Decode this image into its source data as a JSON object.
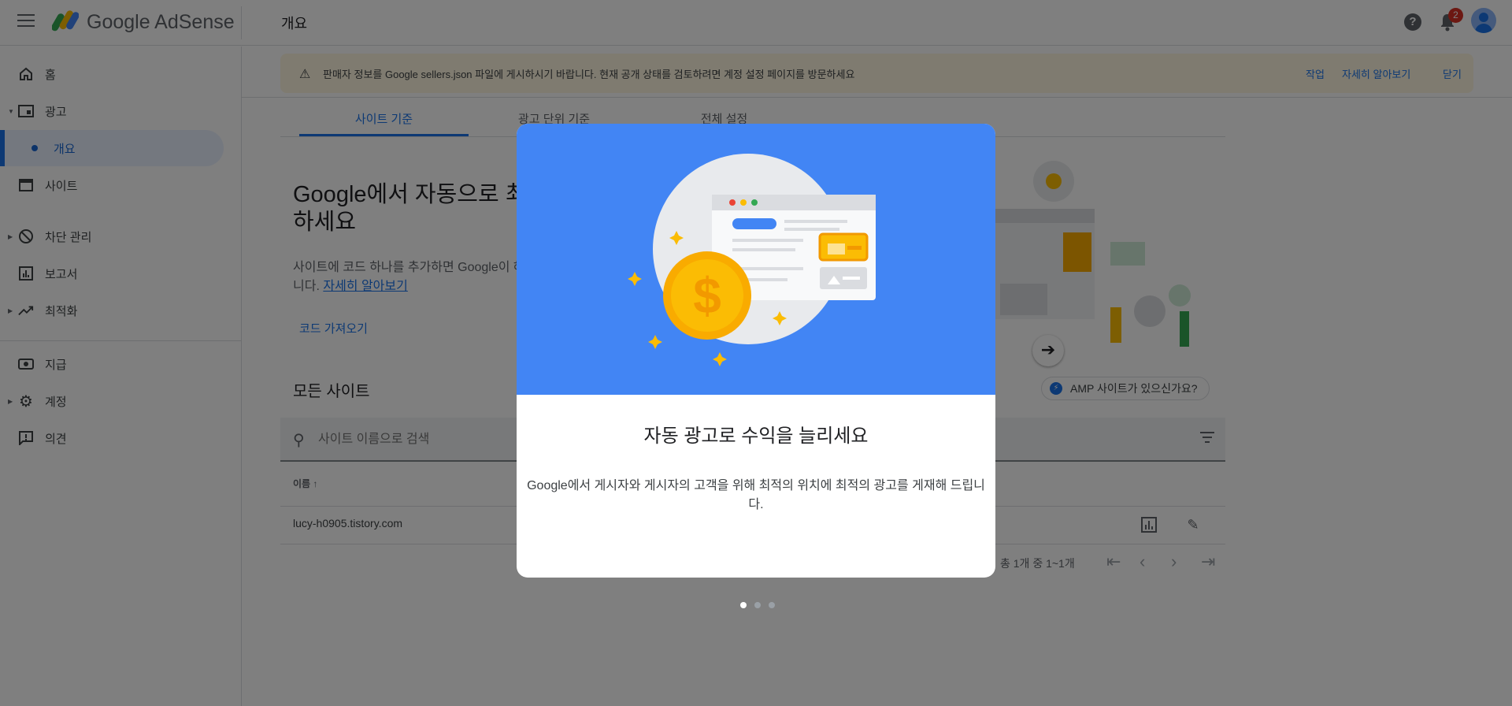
{
  "header": {
    "product_name": "Google AdSense",
    "page_title": "개요",
    "notification_count": "2"
  },
  "sidebar": {
    "items": [
      {
        "label": "홈",
        "icon": "home-icon"
      },
      {
        "label": "광고",
        "icon": "ads-icon"
      },
      {
        "label": "개요",
        "icon": "dot-icon"
      },
      {
        "label": "사이트",
        "icon": "sites-icon"
      },
      {
        "label": "차단 관리",
        "icon": "block-icon"
      },
      {
        "label": "보고서",
        "icon": "report-icon"
      },
      {
        "label": "최적화",
        "icon": "optimize-icon"
      },
      {
        "label": "지급",
        "icon": "payment-icon"
      },
      {
        "label": "계정",
        "icon": "gear-icon"
      },
      {
        "label": "의견",
        "icon": "feedback-icon"
      }
    ]
  },
  "banner": {
    "message": "판매자 정보를 Google sellers.json 파일에 게시하시기 바랍니다. 현재 공개 상태를 검토하려면 계정 설정 페이지를 방문하세요",
    "action_label": "작업",
    "learn_more_label": "자세히 알아보기",
    "close_label": "닫기"
  },
  "tabs": [
    {
      "label": "사이트 기준"
    },
    {
      "label": "광고 단위 기준"
    },
    {
      "label": "전체 설정"
    }
  ],
  "hero": {
    "title": "Google에서 자동으로 최 하도록 하세요",
    "description": "사이트에 코드 하나를 추가하면 Google이 해 줍니다.",
    "learn_more_link": "자세히 알아보기",
    "get_code_label": "코드 가져오기"
  },
  "sites": {
    "heading": "모든 사이트",
    "amp_chip_label": "AMP 사이트가 있으신가요?",
    "search_placeholder": "사이트 이름으로 검색",
    "column_name": "이름 ↑",
    "rows": [
      {
        "name": "lucy-h0905.tistory.com"
      }
    ],
    "pagination_text": "총 1개 중 1~1개"
  },
  "modal": {
    "title": "자동 광고로 수익을 늘리세요",
    "description": "Google에서 게시자와 게시자의 고객을 위해 최적의 위치에 최적의 광고를 게재해 드립니다.",
    "page_count": 3,
    "current_page": 1
  },
  "colors": {
    "brand_blue": "#1a73e8",
    "modal_hero_blue": "#4285f4",
    "coin_yellow": "#fbbc04",
    "badge_red": "#d93025"
  }
}
